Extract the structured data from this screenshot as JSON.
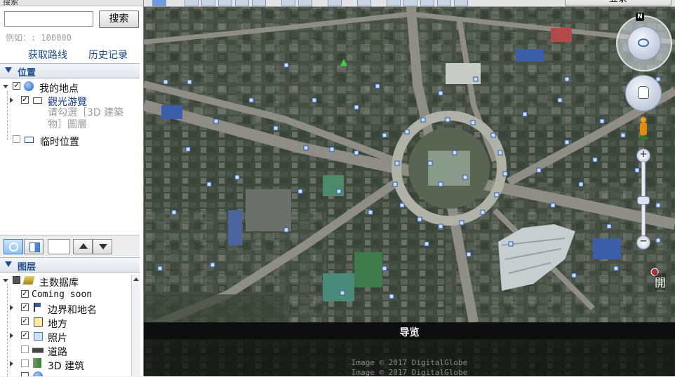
{
  "search": {
    "panel_title": "搜索",
    "button_label": "搜索",
    "example_text": "例如：: 100000",
    "get_route": "获取路线",
    "history": "历史记录"
  },
  "places": {
    "title": "位置",
    "items": [
      {
        "label": "我的地点",
        "checked": true
      },
      {
        "label": "觀光游覽",
        "checked": true
      },
      {
        "label": "临时位置",
        "checked": false
      }
    ],
    "note": "请勾選［3D 建築物］圖層"
  },
  "layers": {
    "title": "图层",
    "items": [
      {
        "label": "主数据库"
      },
      {
        "label": "Coming soon"
      },
      {
        "label": "边界和地名"
      },
      {
        "label": "地方"
      },
      {
        "label": "照片"
      },
      {
        "label": "道路"
      },
      {
        "label": "3D 建筑"
      }
    ]
  },
  "map": {
    "sign_in": "登录",
    "nav_label": "导览",
    "copyright": "Image © 2017 DigitalGlobe",
    "north_label": "N",
    "edge_label": "開"
  },
  "colors": {
    "accent": "#1f4e8c",
    "link": "#1a4a8a",
    "nav_bg": "#0e0e0e"
  }
}
